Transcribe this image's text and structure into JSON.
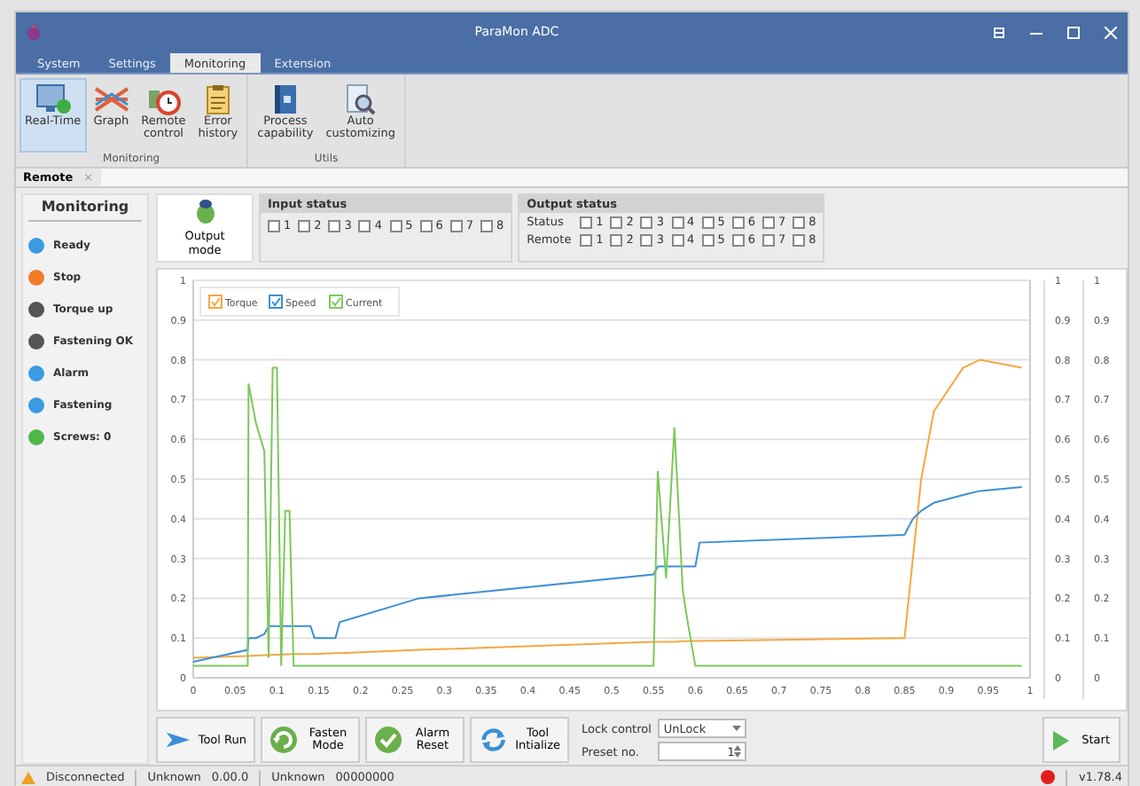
{
  "window": {
    "title": "ParaMon ADC"
  },
  "menu_tabs": [
    {
      "label": "System",
      "selected": false
    },
    {
      "label": "Settings",
      "selected": false
    },
    {
      "label": "Monitoring",
      "selected": true
    },
    {
      "label": "Extension",
      "selected": false
    }
  ],
  "ribbon": {
    "groups": [
      {
        "label": "Monitoring",
        "items": [
          {
            "label": "Real-Time",
            "kind": "screen",
            "selected": true
          },
          {
            "label": "Graph",
            "kind": "graph",
            "selected": false
          },
          {
            "label": "Remote\ncontrol",
            "kind": "remote",
            "selected": false
          },
          {
            "label": "Error\nhistory",
            "kind": "clipboard",
            "selected": false
          }
        ]
      },
      {
        "label": "Utils",
        "items": [
          {
            "label": "Process\ncapability",
            "kind": "book",
            "selected": false
          },
          {
            "label": "Auto\ncustomizing",
            "kind": "magnifier",
            "selected": false
          }
        ]
      }
    ]
  },
  "document_tab": {
    "label": "Remote",
    "close": "×"
  },
  "monitoring": {
    "title": "Monitoring",
    "items": [
      {
        "label": "Ready",
        "color": "#3b9ae1"
      },
      {
        "label": "Stop",
        "color": "#f07c28"
      },
      {
        "label": "Torque up",
        "color": "#555555"
      },
      {
        "label": "Fastening OK",
        "color": "#555555"
      },
      {
        "label": "Alarm",
        "color": "#3b9ae1"
      },
      {
        "label": "Fastening",
        "color": "#3b9ae1"
      },
      {
        "label": "Screws: 0",
        "color": "#4cb848"
      }
    ]
  },
  "output_mode": {
    "label": "Output mode"
  },
  "input_status": {
    "title": "Input status",
    "inputs": [
      {
        "label": "1",
        "checked": false
      },
      {
        "label": "2",
        "checked": false
      },
      {
        "label": "3",
        "checked": false
      },
      {
        "label": "4",
        "checked": false
      },
      {
        "label": "5",
        "checked": false
      },
      {
        "label": "6",
        "checked": false
      },
      {
        "label": "7",
        "checked": false
      },
      {
        "label": "8",
        "checked": false
      }
    ]
  },
  "output_status": {
    "title": "Output status",
    "rows": [
      {
        "label": "Status",
        "outputs": [
          {
            "label": "1",
            "checked": false
          },
          {
            "label": "2",
            "checked": false
          },
          {
            "label": "3",
            "checked": false
          },
          {
            "label": "4",
            "checked": false
          },
          {
            "label": "5",
            "checked": false
          },
          {
            "label": "6",
            "checked": false
          },
          {
            "label": "7",
            "checked": false
          },
          {
            "label": "8",
            "checked": false
          }
        ]
      },
      {
        "label": "Remote",
        "outputs": [
          {
            "label": "1",
            "checked": false
          },
          {
            "label": "2",
            "checked": false
          },
          {
            "label": "3",
            "checked": false
          },
          {
            "label": "4",
            "checked": false
          },
          {
            "label": "5",
            "checked": false
          },
          {
            "label": "6",
            "checked": false
          },
          {
            "label": "7",
            "checked": false
          },
          {
            "label": "8",
            "checked": false
          }
        ]
      }
    ]
  },
  "graph": {
    "chart_data": {
      "type": "line",
      "x": [
        0,
        0.065,
        0.066,
        0.075,
        0.085,
        0.09,
        0.095,
        0.1,
        0.105,
        0.11,
        0.115,
        0.12,
        0.14,
        0.145,
        0.17,
        0.175,
        0.27,
        0.55,
        0.555,
        0.565,
        0.575,
        0.585,
        0.59,
        0.6,
        0.605,
        0.85,
        0.86,
        0.87,
        0.885,
        0.92,
        0.94,
        0.99
      ],
      "series": [
        {
          "name": "Torque",
          "color": "#f5a742",
          "values": [
            0.05,
            0.055,
            0.055,
            0.056,
            0.057,
            0.057,
            0.058,
            0.058,
            0.058,
            0.059,
            0.059,
            0.06,
            0.06,
            0.06,
            0.062,
            0.062,
            0.07,
            0.09,
            0.09,
            0.09,
            0.09,
            0.092,
            0.092,
            0.093,
            0.093,
            0.1,
            0.3,
            0.5,
            0.67,
            0.78,
            0.8,
            0.78
          ]
        },
        {
          "name": "Speed",
          "color": "#3a8fd8",
          "values": [
            0.04,
            0.07,
            0.1,
            0.1,
            0.11,
            0.13,
            0.13,
            0.13,
            0.13,
            0.13,
            0.13,
            0.13,
            0.13,
            0.1,
            0.1,
            0.14,
            0.2,
            0.26,
            0.28,
            0.28,
            0.28,
            0.28,
            0.28,
            0.28,
            0.34,
            0.36,
            0.4,
            0.42,
            0.44,
            0.46,
            0.47,
            0.48
          ]
        },
        {
          "name": "Current",
          "color": "#7cc85a",
          "values": [
            0.03,
            0.03,
            0.74,
            0.64,
            0.57,
            0.05,
            0.78,
            0.78,
            0.03,
            0.42,
            0.42,
            0.03,
            0.03,
            0.03,
            0.03,
            0.03,
            0.03,
            0.03,
            0.52,
            0.25,
            0.63,
            0.22,
            0.15,
            0.03,
            0.03,
            0.03,
            0.03,
            0.03,
            0.03,
            0.03,
            0.03,
            0.03
          ]
        }
      ],
      "xlim": [
        0,
        1
      ],
      "ylim": [
        0,
        1
      ],
      "grid": true,
      "legend": true,
      "xticks": [
        0,
        0.05,
        0.1,
        0.15,
        0.2,
        0.25,
        0.3,
        0.35,
        0.4,
        0.45,
        0.5,
        0.55,
        0.6,
        0.65,
        0.7,
        0.75,
        0.8,
        0.85,
        0.9,
        0.95,
        1
      ],
      "yticks": [
        0,
        0.1,
        0.2,
        0.3,
        0.4,
        0.5,
        0.6,
        0.7,
        0.8,
        0.9,
        1
      ]
    },
    "legend_items": [
      {
        "checked": true
      },
      {
        "checked": true
      },
      {
        "checked": true
      }
    ],
    "right_axes": [
      {
        "ticks": [
          "1",
          "0.9",
          "0.8",
          "0.7",
          "0.6",
          "0.5",
          "0.4",
          "0.3",
          "0.2",
          "0.1",
          "0"
        ]
      },
      {
        "ticks": [
          "1",
          "0.9",
          "0.8",
          "0.7",
          "0.6",
          "0.5",
          "0.4",
          "0.3",
          "0.2",
          "0.1",
          "0"
        ]
      }
    ]
  },
  "actions": [
    {
      "label": "Tool Run",
      "kind": "arrow"
    },
    {
      "label": "Fasten\nMode",
      "kind": "cycle"
    },
    {
      "label": "Alarm\nReset",
      "kind": "check"
    },
    {
      "label": "Tool\nIntialize",
      "kind": "refresh"
    }
  ],
  "lock_control": {
    "label": "Lock control",
    "value": "UnLock"
  },
  "preset": {
    "label": "Preset no.",
    "value": "1"
  },
  "start": {
    "label": "Start"
  },
  "status_bar": {
    "connection": "Disconnected",
    "fields": [
      "Unknown",
      "0.00.0",
      "Unknown",
      "00000000"
    ],
    "version": "v1.78.4"
  }
}
